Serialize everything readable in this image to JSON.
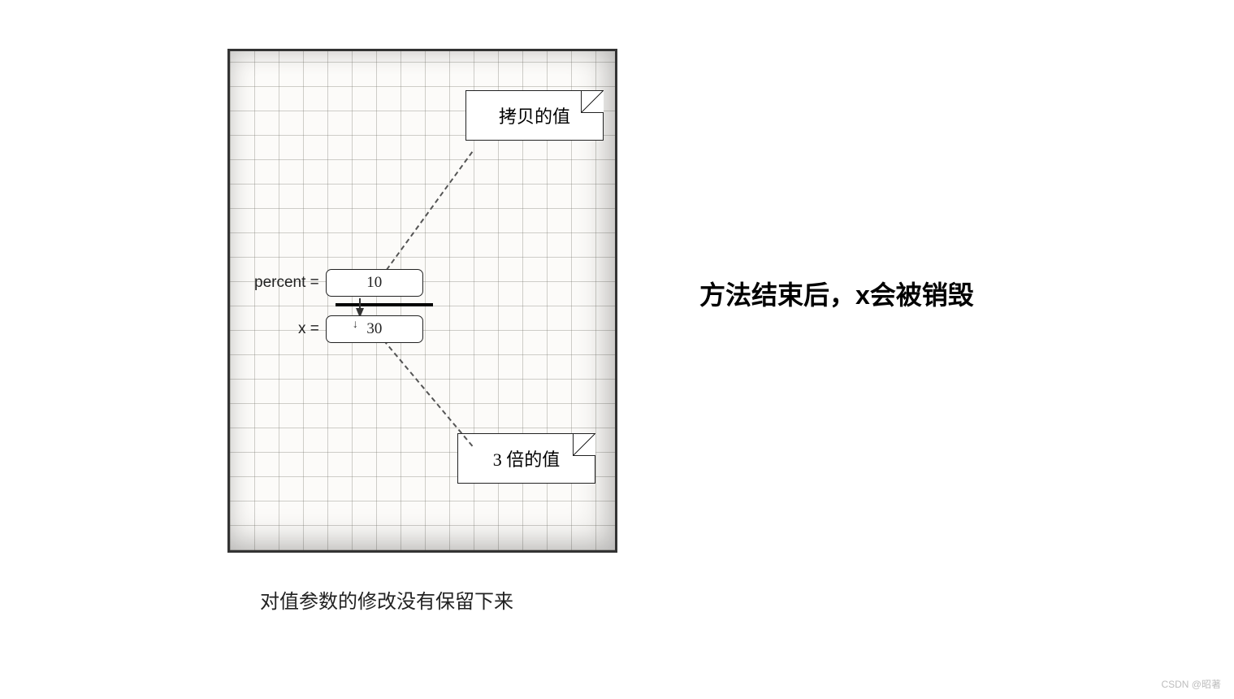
{
  "diagram": {
    "note_top": "拷贝的值",
    "note_bottom": "3 倍的值",
    "percent_label": "percent =",
    "percent_value": "10",
    "x_label": "x =",
    "x_value": "30",
    "caption": "对值参数的修改没有保留下来"
  },
  "side_note": "方法结束后，x会被销毁",
  "watermark": "CSDN @昭著"
}
